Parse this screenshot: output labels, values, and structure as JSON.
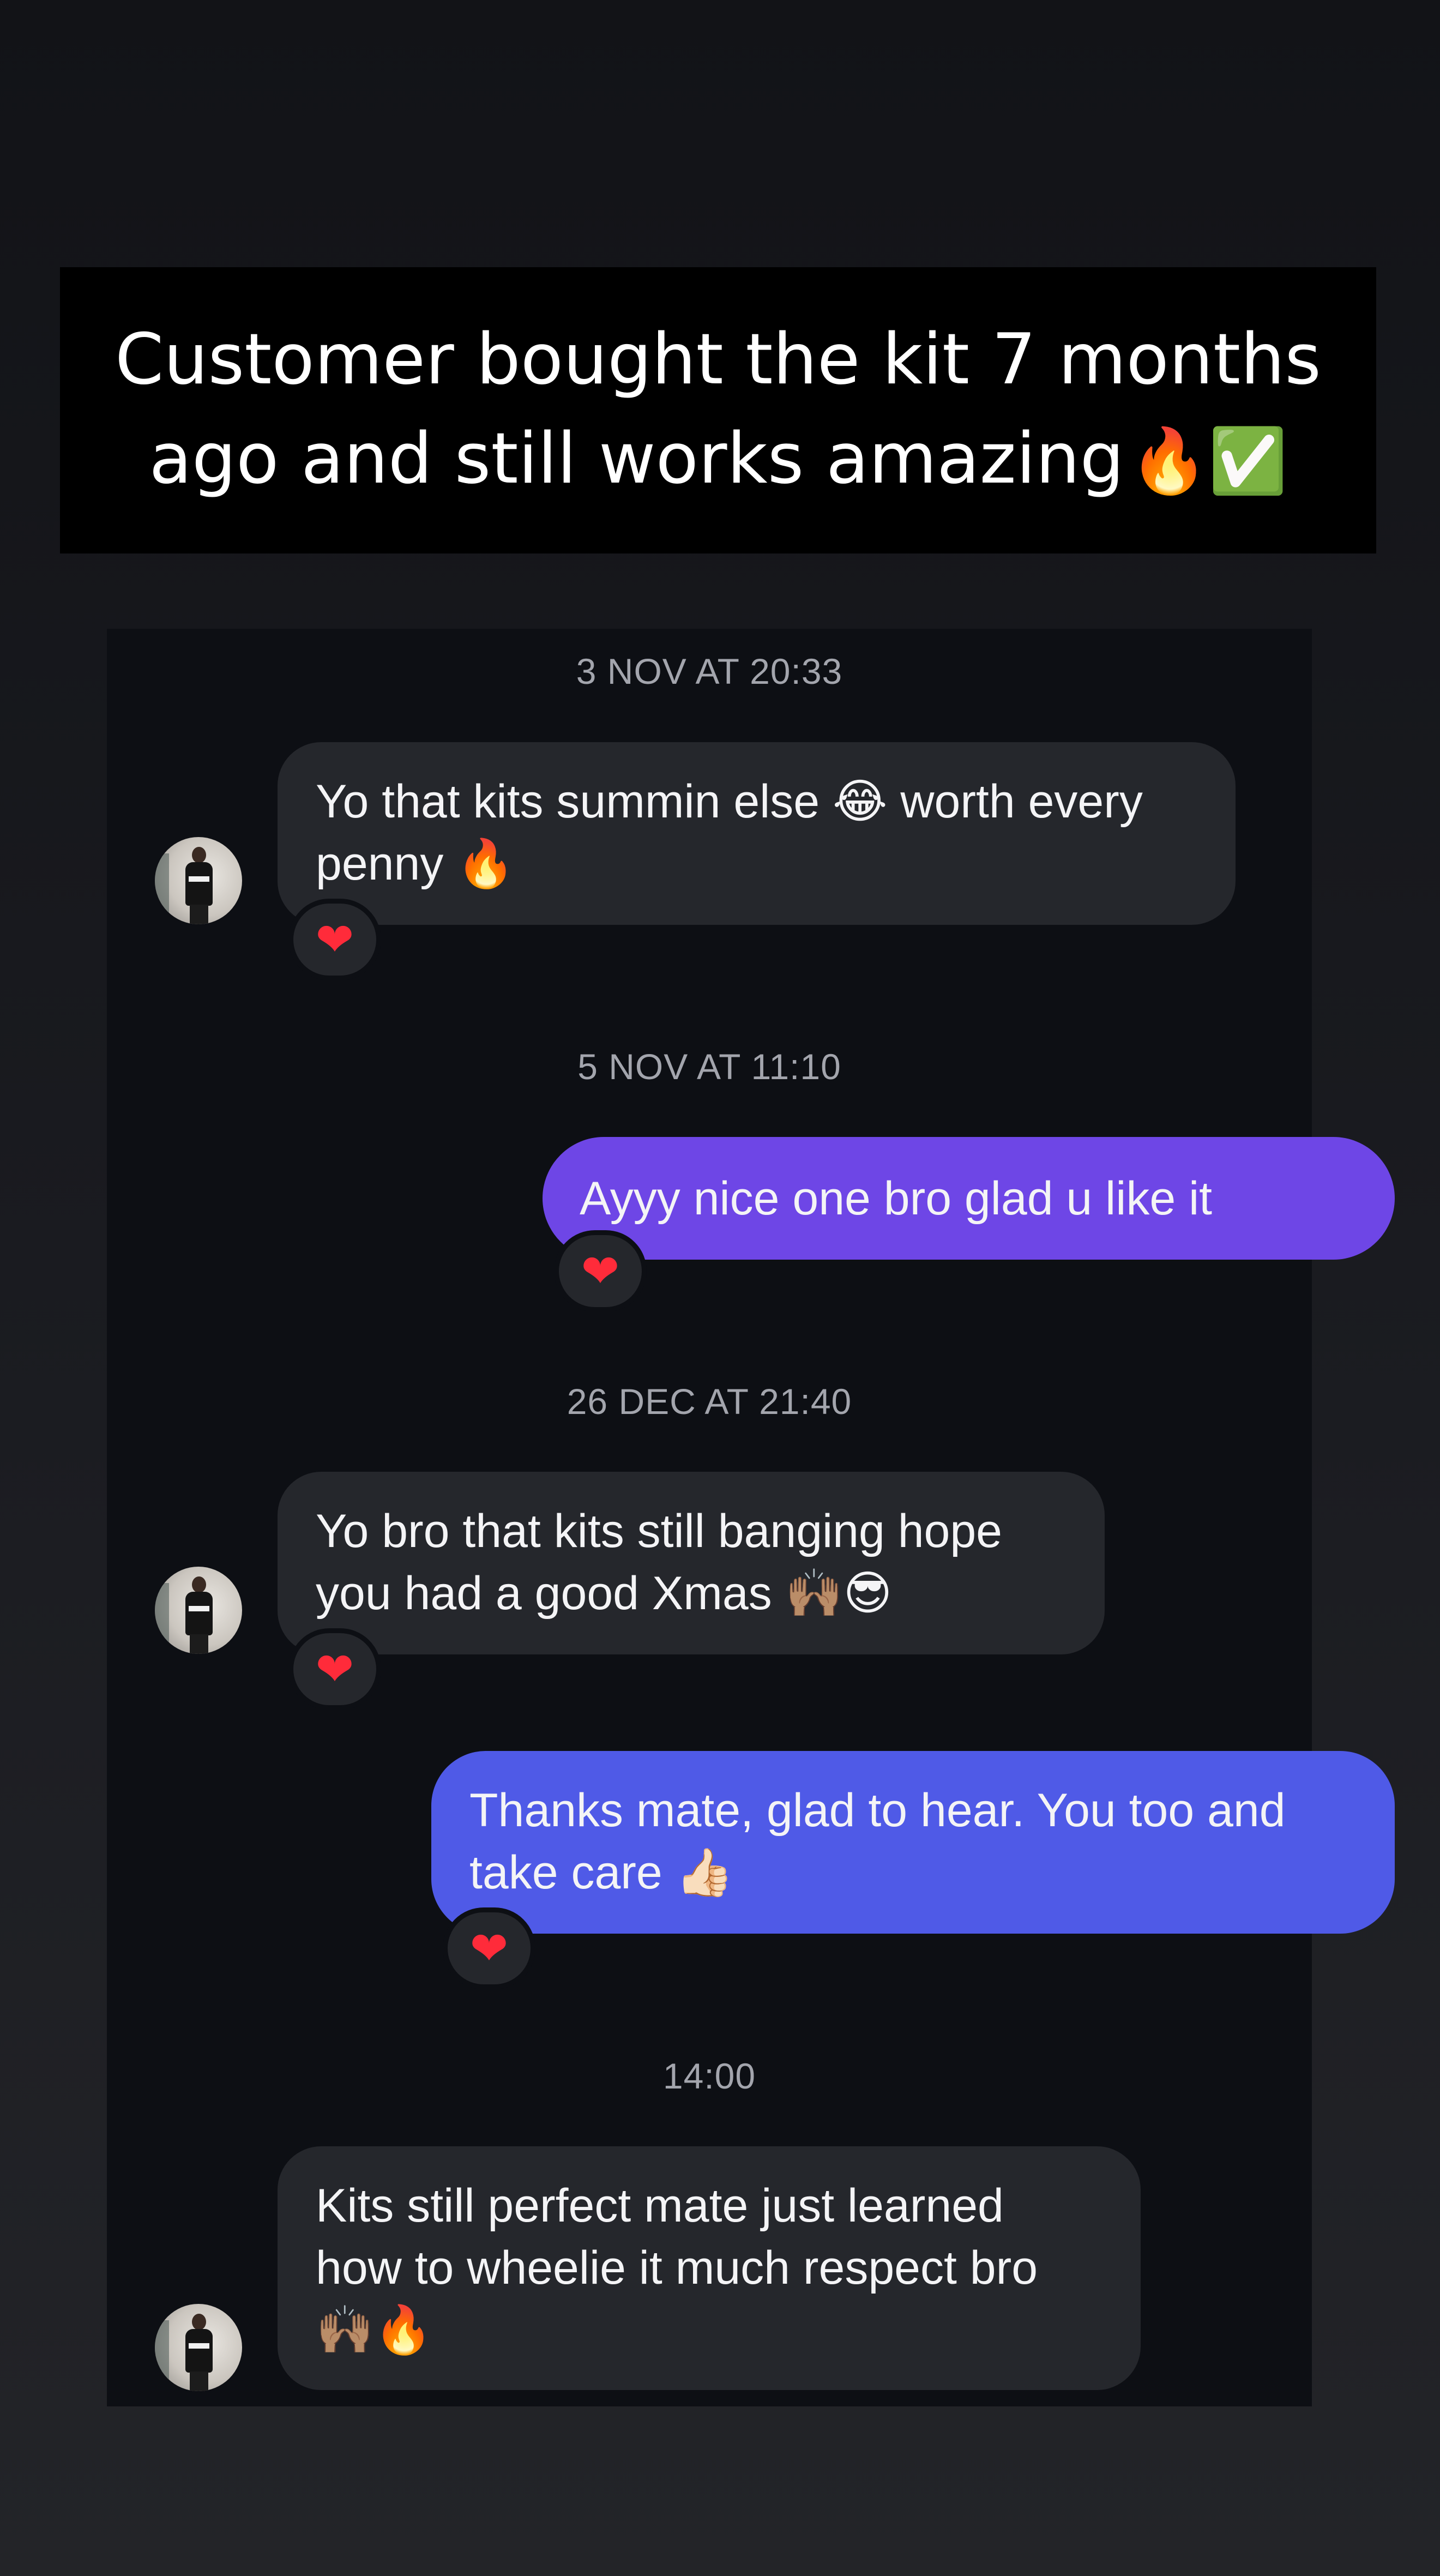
{
  "caption": {
    "text": "Customer bought the kit 7 months ago and still works amazing",
    "emojis": "🔥✅"
  },
  "conversation": [
    {
      "timestamp": "3 NOV AT 20:33",
      "message": {
        "direction": "received",
        "text": "Yo that kits summin else 😂 worth every penny 🔥",
        "reaction": "❤"
      }
    },
    {
      "timestamp": "5 NOV AT 11:10",
      "message": {
        "direction": "sent",
        "text": "Ayyy nice one bro glad u like it",
        "reaction": "❤"
      }
    },
    {
      "timestamp": "26 DEC AT 21:40",
      "message": {
        "direction": "received",
        "text": "Yo bro that kits still banging hope you had a good Xmas 🙌🏽😎",
        "reaction": "❤"
      }
    },
    {
      "message": {
        "direction": "sent",
        "text": "Thanks mate, glad to hear. You too and take care 👍🏻",
        "reaction": "❤"
      }
    },
    {
      "timestamp": "14:00",
      "message": {
        "direction": "received",
        "text": "Kits still perfect mate just learned how to wheelie it much respect bro 🙌🏽🔥"
      }
    }
  ],
  "colors": {
    "background": "#16171b",
    "panel": "#0d0f14",
    "received_bubble": "#25272c",
    "sent_bubble_purple": "#6e46e6",
    "sent_bubble_blue": "#4f5ae7",
    "reaction_heart": "#ff2b3a",
    "timestamp_text": "#a3a5ad"
  },
  "icons": {
    "reaction": "heart-icon",
    "avatar": "user-avatar"
  }
}
